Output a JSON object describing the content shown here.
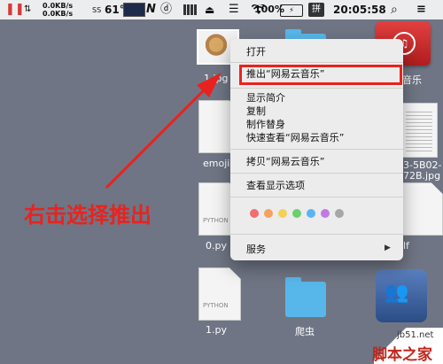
{
  "menubar": {
    "net_up": "0.0KB/s",
    "net_down": "0.0KB/s",
    "ss_top": "SS",
    "ss_bottom": "",
    "temperature": "61°",
    "battery_pct": "100%",
    "input_method": "拼",
    "clock": "20:05:58",
    "icons": [
      "pause-icon",
      "up-down-arrows-icon",
      "activity-graph-icon",
      "n-icon",
      "d-icon",
      "battery-bars-icon",
      "tray-icon",
      "menu-dots-icon",
      "wifi-icon",
      "battery-icon",
      "search-icon",
      "list-icon"
    ]
  },
  "desktop": {
    "items": [
      {
        "label": "1.jpg",
        "kind": "image"
      },
      {
        "label": "",
        "kind": "folder"
      },
      {
        "label": "音乐",
        "kind": "disk"
      },
      {
        "label": "emoji",
        "kind": "document"
      },
      {
        "label": "3-5B02-",
        "kind": "document"
      },
      {
        "label": "72B.jpg",
        "kind": "document"
      },
      {
        "label": "0.py",
        "kind": "python"
      },
      {
        "label": "lf",
        "kind": "document"
      },
      {
        "label": "1.py",
        "kind": "python"
      },
      {
        "label": "爬虫",
        "kind": "folder"
      },
      {
        "label": "",
        "kind": "server"
      }
    ],
    "doc_tag": "PYTHON"
  },
  "context_menu": {
    "items": {
      "open": "打开",
      "eject": "推出“网易云音乐”",
      "get_info": "显示简介",
      "duplicate": "复制",
      "make_alias": "制作替身",
      "quick_look": "快速查看“网易云音乐”",
      "copy": "拷贝“网易云音乐”",
      "view_options": "查看显示选项",
      "services": "服务"
    },
    "tag_colors": [
      "#f26d6d",
      "#f5a25c",
      "#f1d15a",
      "#6bd06b",
      "#5ab4f4",
      "#c27ae0",
      "#a7a7a7"
    ]
  },
  "annotation": {
    "text": "右击选择推出",
    "color": "#e8231f"
  },
  "watermark": {
    "url": "jb51.net",
    "text": "脚本之家"
  }
}
